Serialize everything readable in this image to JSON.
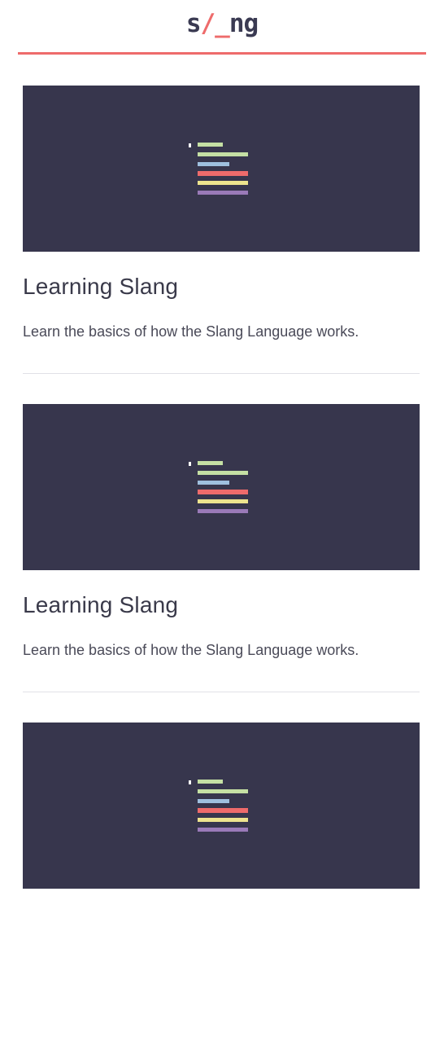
{
  "header": {
    "logo_left": "s",
    "logo_accent": "/_",
    "logo_right": "ng"
  },
  "cards": [
    {
      "title": "Learning Slang",
      "description": "Learn the basics of how the Slang Language works.",
      "image_icon": "code-lines-icon"
    },
    {
      "title": "Learning Slang",
      "description": "Learn the basics of how the Slang Language works.",
      "image_icon": "code-lines-icon"
    },
    {
      "title": "",
      "description": "",
      "image_icon": "code-lines-icon"
    }
  ],
  "colors": {
    "accent": "#ee6b6b",
    "card_background": "#37364d",
    "code_line_colors": [
      "#c5e0a4",
      "#c5e0a4",
      "#9fc0df",
      "#ee6b6b",
      "#ede48e",
      "#9a7ab8"
    ]
  }
}
